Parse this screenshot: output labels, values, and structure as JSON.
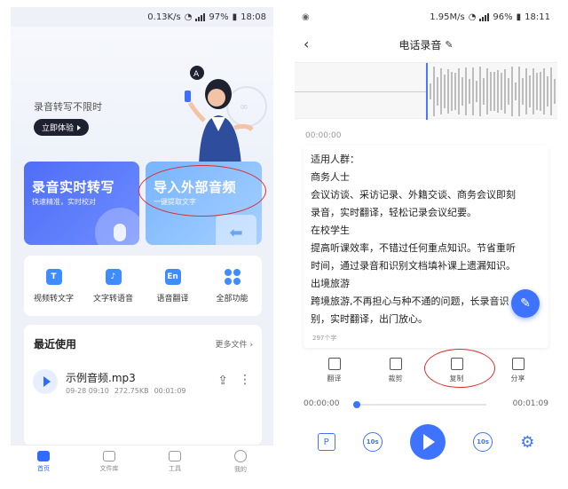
{
  "left": {
    "status": {
      "speed": "0.13K/s",
      "battery": "97%",
      "time": "18:08"
    },
    "hero": {
      "tagline": "录音转写不限时",
      "button": "立即体验"
    },
    "cards": [
      {
        "title": "录音实时转写",
        "subtitle": "快速精准，实时校对"
      },
      {
        "title": "导入外部音频",
        "subtitle": "一键提取文字"
      }
    ],
    "features": [
      {
        "label": "视频转文字",
        "icon": "video-to-text-icon"
      },
      {
        "label": "文字转语音",
        "icon": "text-to-speech-icon"
      },
      {
        "label": "语音翻译",
        "icon": "voice-translate-icon"
      },
      {
        "label": "全部功能",
        "icon": "all-functions-icon"
      }
    ],
    "recent": {
      "title": "最近使用",
      "more": "更多文件",
      "file": {
        "name": "示例音频.mp3",
        "date": "09-28 09:10",
        "size": "272.75KB",
        "duration": "00:01:09"
      }
    },
    "tabs": [
      {
        "label": "首页",
        "active": true
      },
      {
        "label": "文件库",
        "active": false
      },
      {
        "label": "工具",
        "active": false
      },
      {
        "label": "我的",
        "active": false
      }
    ]
  },
  "right": {
    "status": {
      "speed": "1.95M/s",
      "battery": "96%",
      "time": "18:11"
    },
    "title": "电话录音",
    "timestamp": "00:00:00",
    "transcript": [
      "适用人群：",
      "商务人士",
      "会议访谈、采访记录、外籍交谈、商务会议即刻",
      "录音，实时翻译，轻松记录会议纪要。",
      "在校学生",
      "提高听课效率，不错过任何重点知识。节省重听",
      "时间，通过录音和识别文档填补课上遗漏知识。",
      "出境旅游",
      "跨境旅游,不再担心与种不通的问题，长录音识",
      "别，实时翻译，出门放心。"
    ],
    "char_count": "297个字",
    "actions": [
      "翻译",
      "裁剪",
      "复制",
      "分享"
    ],
    "player": {
      "current": "00:00:00",
      "total": "00:01:09",
      "progress": 0.0
    },
    "controls": {
      "rewind": "10s",
      "forward": "10s"
    }
  },
  "colors": {
    "accent": "#3d73ff",
    "card_a": "#4f6ef7",
    "card_b": "#78b4ff",
    "annotation": "#d9302c"
  }
}
